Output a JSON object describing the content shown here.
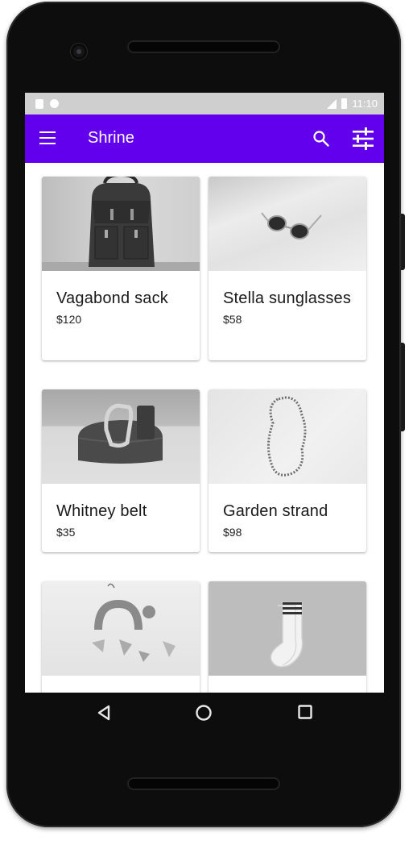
{
  "status_bar": {
    "time": "11:10"
  },
  "app_bar": {
    "title": "Shrine",
    "menu_icon": "menu-icon",
    "search_icon": "search-icon",
    "filter_icon": "tune-icon",
    "color": "#6200ee"
  },
  "products": [
    {
      "name": "Vagabond sack",
      "price": "$120",
      "image": "backpack"
    },
    {
      "name": "Stella sunglasses",
      "price": "$58",
      "image": "sunglasses"
    },
    {
      "name": "Whitney belt",
      "price": "$35",
      "image": "belt"
    },
    {
      "name": "Garden strand",
      "price": "$98",
      "image": "necklace"
    },
    {
      "name": "",
      "price": "",
      "image": "earrings"
    },
    {
      "name": "",
      "price": "",
      "image": "socks"
    }
  ],
  "nav_bar": {
    "back_icon": "back-icon",
    "home_icon": "home-icon",
    "recents_icon": "recents-icon"
  }
}
